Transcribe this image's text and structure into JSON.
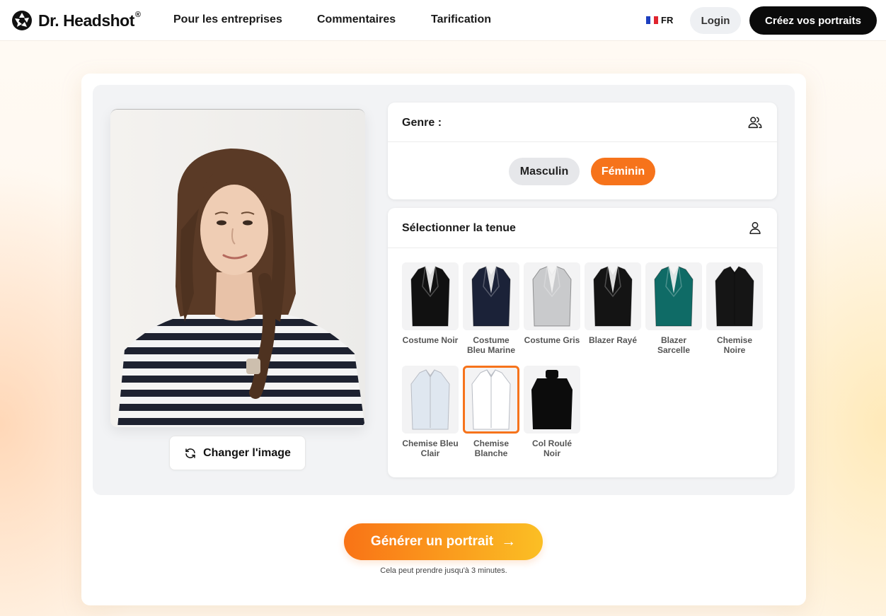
{
  "brand": {
    "name": "Dr. Headshot",
    "reg": "®"
  },
  "nav": {
    "links": [
      "Pour les entreprises",
      "Commentaires",
      "Tarification"
    ],
    "lang": "FR",
    "login": "Login",
    "cta": "Créez vos portraits"
  },
  "photo": {
    "change_label": "Changer l'image"
  },
  "gender": {
    "title": "Genre :",
    "options": [
      "Masculin",
      "Féminin"
    ],
    "selected": "Féminin"
  },
  "outfit": {
    "title": "Sélectionner la tenue",
    "items": [
      {
        "label": "Costume Noir",
        "color": "#111111",
        "type": "suit"
      },
      {
        "label": "Costume Bleu Marine",
        "color": "#1b2238",
        "type": "suit"
      },
      {
        "label": "Costume Gris",
        "color": "#c9cacc",
        "type": "suit"
      },
      {
        "label": "Blazer Rayé",
        "color": "#141414",
        "type": "suit"
      },
      {
        "label": "Blazer Sarcelle",
        "color": "#0f6b66",
        "type": "suit"
      },
      {
        "label": "Chemise Noire",
        "color": "#151515",
        "type": "shirt"
      },
      {
        "label": "Chemise Bleu Clair",
        "color": "#dfe7f0",
        "type": "shirt"
      },
      {
        "label": "Chemise Blanche",
        "color": "#ffffff",
        "type": "shirt"
      },
      {
        "label": "Col Roulé Noir",
        "color": "#0c0c0c",
        "type": "turtleneck"
      }
    ],
    "selected": "Chemise Blanche"
  },
  "generate": {
    "label": "Générer un portrait",
    "arrow": "→",
    "note": "Cela peut prendre jusqu'à 3 minutes."
  },
  "colors": {
    "accent": "#f6731b",
    "dark": "#0b0b0b"
  }
}
